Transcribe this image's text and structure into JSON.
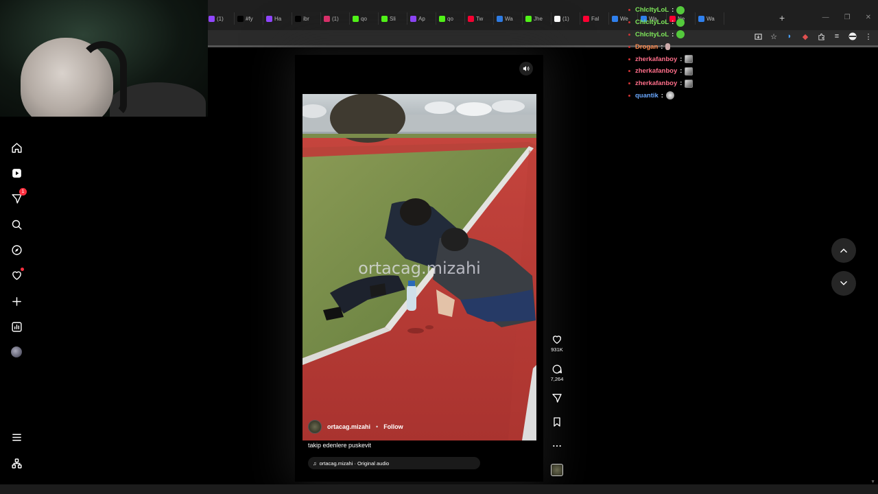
{
  "browser": {
    "tabs": [
      {
        "label": "(1)",
        "color": "#9146ff"
      },
      {
        "label": "#fy",
        "color": "#000000"
      },
      {
        "label": "Ha",
        "color": "#9146ff"
      },
      {
        "label": "ibr",
        "color": "#000000"
      },
      {
        "label": "(1)",
        "color": "#e1306c"
      },
      {
        "label": "qo",
        "color": "#53fc18"
      },
      {
        "label": "Sli",
        "color": "#53fc18"
      },
      {
        "label": "Ap",
        "color": "#9146ff"
      },
      {
        "label": "qo",
        "color": "#53fc18"
      },
      {
        "label": "Tw",
        "color": "#ff0033"
      },
      {
        "label": "Wa",
        "color": "#2f80ed"
      },
      {
        "label": "Jhe",
        "color": "#53fc18"
      },
      {
        "label": "(1)",
        "color": "#ffffff"
      },
      {
        "label": "Fal",
        "color": "#ff0033"
      },
      {
        "label": "We",
        "color": "#2f80ed"
      },
      {
        "label": "Wa",
        "color": "#2f80ed"
      },
      {
        "label": "Ne",
        "color": "#ff0033"
      },
      {
        "label": "Wa",
        "color": "#2f80ed"
      }
    ],
    "new_tab": "+",
    "window_controls": [
      "—",
      "❐",
      "✕"
    ]
  },
  "sidebar": {
    "notifications_count": "1"
  },
  "reel": {
    "watermark": "ortacag.mizahi",
    "username": "ortacag.mizahi",
    "separator": "•",
    "follow_label": "Follow",
    "caption": "takip edenlere puskevit",
    "audio": "ortacag.mizahi · Original audio"
  },
  "actions": {
    "likes": "931K",
    "comments": "7,264"
  },
  "chat": [
    {
      "user": "ChIcItyLoL",
      "color": "#7ee65a",
      "emote": "green"
    },
    {
      "user": "ChIcItyLoL",
      "color": "#7ee65a",
      "emote": "green"
    },
    {
      "user": "ChIcItyLoL",
      "color": "#7ee65a",
      "emote": "green"
    },
    {
      "user": "Drogan",
      "color": "#ff8c50",
      "emote": "small"
    },
    {
      "user": "zherkafanboy",
      "color": "#ff6f8a",
      "emote": "gray"
    },
    {
      "user": "zherkafanboy",
      "color": "#ff6f8a",
      "emote": "gray"
    },
    {
      "user": "zherkafanboy",
      "color": "#ff6f8a",
      "emote": "gray"
    },
    {
      "user": "quantik",
      "color": "#6aa8ff",
      "emote": "round"
    }
  ]
}
